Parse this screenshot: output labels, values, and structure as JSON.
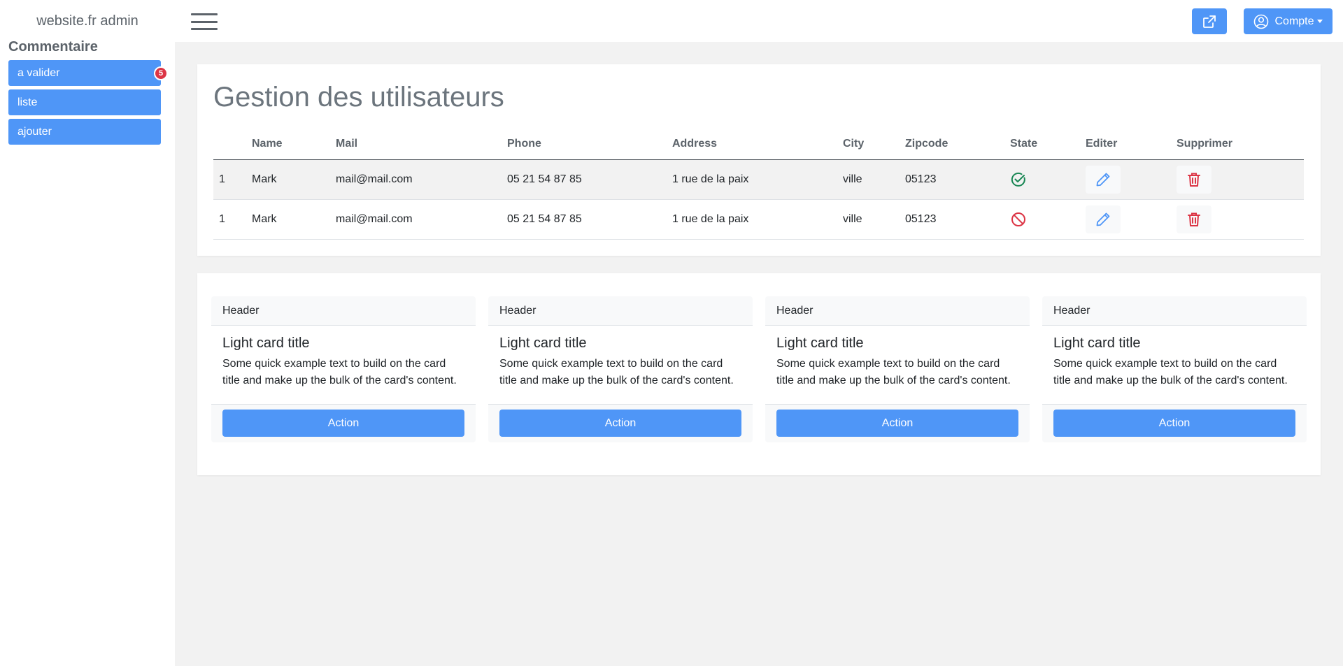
{
  "app": {
    "brand": "website.fr admin"
  },
  "header": {
    "account_label": "Compte",
    "accent_color": "#4f96f7"
  },
  "sidebar": {
    "section_title": "Commentaire",
    "items": [
      {
        "label": "a valider",
        "badge": "5"
      },
      {
        "label": "liste"
      },
      {
        "label": "ajouter"
      }
    ]
  },
  "main": {
    "title": "Gestion des utilisateurs",
    "table": {
      "columns": [
        "",
        "Name",
        "Mail",
        "Phone",
        "Address",
        "City",
        "Zipcode",
        "State",
        "Editer",
        "Supprimer"
      ],
      "rows": [
        {
          "id": "1",
          "name": "Mark",
          "mail": "mail@mail.com",
          "phone": "05 21 54 87 85",
          "address": "1 rue de la paix",
          "city": "ville",
          "zipcode": "05123",
          "state": "check-circle-icon",
          "state_color": "#198754"
        },
        {
          "id": "1",
          "name": "Mark",
          "mail": "mail@mail.com",
          "phone": "05 21 54 87 85",
          "address": "1 rue de la paix",
          "city": "ville",
          "zipcode": "05123",
          "state": "ban-icon",
          "state_color": "#dc3545"
        }
      ]
    }
  },
  "cards": [
    {
      "header": "Header",
      "title": "Light card title",
      "text": "Some quick example text to build on the card title and make up the bulk of the card's content.",
      "action": "Action"
    },
    {
      "header": "Header",
      "title": "Light card title",
      "text": "Some quick example text to build on the card title and make up the bulk of the card's content.",
      "action": "Action"
    },
    {
      "header": "Header",
      "title": "Light card title",
      "text": "Some quick example text to build on the card title and make up the bulk of the card's content.",
      "action": "Action"
    },
    {
      "header": "Header",
      "title": "Light card title",
      "text": "Some quick example text to build on the card title and make up the bulk of the card's content.",
      "action": "Action"
    }
  ]
}
